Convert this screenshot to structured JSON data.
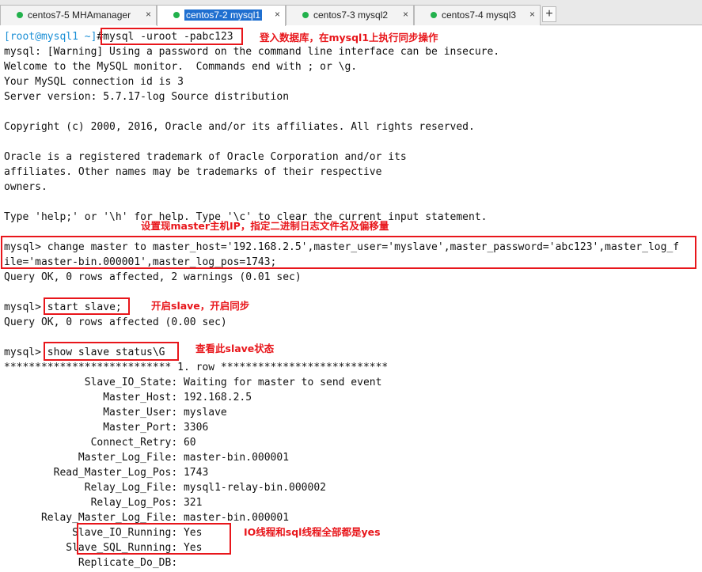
{
  "tabs": [
    {
      "label": "centos7-5 MHAmanager",
      "close": "×",
      "active": false
    },
    {
      "label": "centos7-2 mysql1",
      "close": "×",
      "active": true
    },
    {
      "label": "centos7-3 mysql2",
      "close": "×",
      "active": false
    },
    {
      "label": "centos7-4 mysql3",
      "close": "×",
      "active": false
    }
  ],
  "add_tab_label": "+",
  "terminal": {
    "prompt_user": "[root@mysql1 ~]",
    "prompt_hash": "#",
    "login_cmd": "mysql -uroot -pabc123",
    "lines": [
      "mysql: [Warning] Using a password on the command line interface can be insecure.",
      "Welcome to the MySQL monitor.  Commands end with ; or \\g.",
      "Your MySQL connection id is 3",
      "Server version: 5.7.17-log Source distribution",
      "Copyright (c) 2000, 2016, Oracle and/or its affiliates. All rights reserved.",
      "Oracle is a registered trademark of Oracle Corporation and/or its",
      "affiliates. Other names may be trademarks of their respective",
      "owners.",
      "Type 'help;' or '\\h' for help. Type '\\c' to clear the current input statement."
    ],
    "change_master_1": "mysql> change master to master_host='192.168.2.5',master_user='myslave',master_password='abc123',master_log_f",
    "change_master_2": "ile='master-bin.000001',master_log_pos=1743;",
    "query_ok_1": "Query OK, 0 rows affected, 2 warnings (0.01 sec)",
    "mysql_prompt": "mysql>",
    "start_slave_cmd": "start slave;",
    "query_ok_2": "Query OK, 0 rows affected (0.00 sec)",
    "show_status_cmd": "show slave status\\G",
    "row_header": "*************************** 1. row ***************************",
    "status_rows": [
      "             Slave_IO_State: Waiting for master to send event",
      "                Master_Host: 192.168.2.5",
      "                Master_User: myslave",
      "                Master_Port: 3306",
      "              Connect_Retry: 60",
      "            Master_Log_File: master-bin.000001",
      "        Read_Master_Log_Pos: 1743",
      "             Relay_Log_File: mysql1-relay-bin.000002",
      "              Relay_Log_Pos: 321",
      "      Relay_Master_Log_File: master-bin.000001",
      "           Slave_IO_Running: Yes",
      "          Slave_SQL_Running: Yes",
      "            Replicate_Do_DB:"
    ]
  },
  "annotations": {
    "login": "登入数据库，在mysql1上执行同步操作",
    "set_master": "设置现master主机IP，指定二进制日志文件名及偏移量",
    "start_slave": "开启slave，开启同步",
    "show_status": "查看此slave状态",
    "running": "IO线程和sql线程全部都是yes"
  },
  "colors": {
    "annotation": "#e8161b",
    "prompt": "#1b8fd6",
    "tab_dot": "#22b14c",
    "active_tab": "#1f6fd0"
  }
}
